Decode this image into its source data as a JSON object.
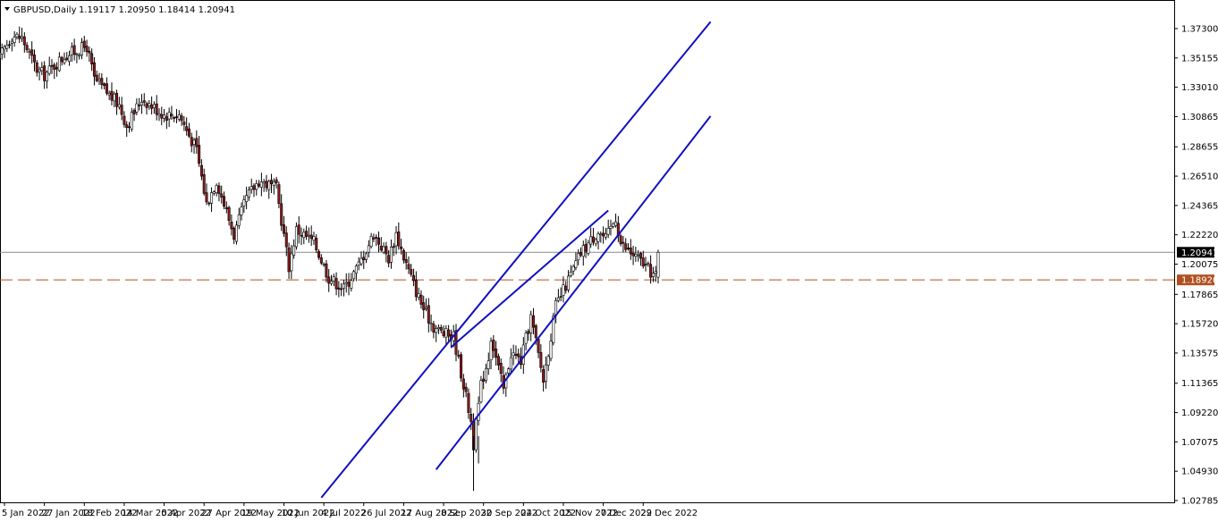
{
  "chart_header": {
    "symbol_label": "GBPUSD,Daily",
    "ohlc_text": "1.19117 1.20950 1.18414 1.20941"
  },
  "price_tags": {
    "current_price": "1.20941",
    "support_level": "1.18920"
  },
  "colors": {
    "background": "#ffffff",
    "bull_candle": "#ffffff",
    "bear_candle": "#8b1a1a",
    "candle_outline": "#000000",
    "channel_line": "#1010c0",
    "support_line": "#b05020",
    "current_line": "#8a8a8a",
    "current_tag_bg": "#000000",
    "support_tag_bg": "#b05020"
  },
  "chart_data": {
    "type": "candlestick",
    "title": "GBPUSD,Daily",
    "ylim": [
      1.02785,
      1.38445
    ],
    "y_ticks": [
      "1.37300",
      "1.35155",
      "1.33010",
      "1.30865",
      "1.28655",
      "1.26510",
      "1.24365",
      "1.22220",
      "1.20075",
      "1.17865",
      "1.15720",
      "1.13575",
      "1.11365",
      "1.09220",
      "1.07075",
      "1.04930",
      "1.02785"
    ],
    "x_ticks": [
      "5 Jan 2022",
      "27 Jan 2022",
      "18 Feb 2022",
      "14 Mar 2022",
      "5 Apr 2022",
      "27 Apr 2022",
      "19 May 2022",
      "10 Jun 2022",
      "4 Jul 2022",
      "26 Jul 2022",
      "17 Aug 2022",
      "8 Sep 2022",
      "30 Sep 2022",
      "24 Oct 2022",
      "15 Nov 2022",
      "7 Dec 2022",
      "29 Dec 2022"
    ],
    "horizontal_lines": [
      {
        "name": "current",
        "value": 1.20941,
        "style": "solid"
      },
      {
        "name": "support",
        "value": 1.1892,
        "style": "dashed"
      }
    ],
    "trend_lines": [
      {
        "name": "channel-upper-long",
        "from": {
          "x": "1 Jul 2022",
          "y": 1.03
        },
        "to": {
          "x": "6 Feb 2023",
          "y": 1.378
        }
      },
      {
        "name": "channel-lower-long",
        "from": {
          "x": "5 Sep 2022",
          "y": 1.0505
        },
        "to": {
          "x": "6 Feb 2023",
          "y": 1.309
        }
      },
      {
        "name": "channel-upper-short",
        "from": {
          "x": "13 Sep 2022",
          "y": 1.14
        },
        "to": {
          "x": "10 Dec 2022",
          "y": 1.24
        }
      }
    ],
    "anchors": [
      {
        "date": "3 Jan 2022",
        "close": 1.352
      },
      {
        "date": "10 Jan 2022",
        "close": 1.368
      },
      {
        "date": "14 Jan 2022",
        "close": 1.366
      },
      {
        "date": "24 Jan 2022",
        "close": 1.343
      },
      {
        "date": "27 Jan 2022",
        "close": 1.339
      },
      {
        "date": "8 Feb 2022",
        "close": 1.353
      },
      {
        "date": "21 Feb 2022",
        "close": 1.36
      },
      {
        "date": "24 Feb 2022",
        "close": 1.336
      },
      {
        "date": "10 Mar 2022",
        "close": 1.317
      },
      {
        "date": "15 Mar 2022",
        "close": 1.302
      },
      {
        "date": "23 Mar 2022",
        "close": 1.322
      },
      {
        "date": "5 Apr 2022",
        "close": 1.31
      },
      {
        "date": "13 Apr 2022",
        "close": 1.31
      },
      {
        "date": "22 Apr 2022",
        "close": 1.284
      },
      {
        "date": "28 Apr 2022",
        "close": 1.245
      },
      {
        "date": "4 May 2022",
        "close": 1.262
      },
      {
        "date": "13 May 2022",
        "close": 1.222
      },
      {
        "date": "20 May 2022",
        "close": 1.249
      },
      {
        "date": "27 May 2022",
        "close": 1.262
      },
      {
        "date": "7 Jun 2022",
        "close": 1.256
      },
      {
        "date": "14 Jun 2022",
        "close": 1.199
      },
      {
        "date": "17 Jun 2022",
        "close": 1.226
      },
      {
        "date": "28 Jun 2022",
        "close": 1.217
      },
      {
        "date": "6 Jul 2022",
        "close": 1.191
      },
      {
        "date": "14 Jul 2022",
        "close": 1.183
      },
      {
        "date": "22 Jul 2022",
        "close": 1.2
      },
      {
        "date": "1 Aug 2022",
        "close": 1.223
      },
      {
        "date": "9 Aug 2022",
        "close": 1.205
      },
      {
        "date": "12 Aug 2022",
        "close": 1.223
      },
      {
        "date": "17 Aug 2022",
        "close": 1.206
      },
      {
        "date": "24 Aug 2022",
        "close": 1.181
      },
      {
        "date": "29 Aug 2022",
        "close": 1.168
      },
      {
        "date": "2 Sep 2022",
        "close": 1.155
      },
      {
        "date": "8 Sep 2022",
        "close": 1.15
      },
      {
        "date": "14 Sep 2022",
        "close": 1.148
      },
      {
        "date": "23 Sep 2022",
        "close": 1.086
      },
      {
        "date": "26 Sep 2022",
        "close": 1.069
      },
      {
        "date": "29 Sep 2022",
        "close": 1.112
      },
      {
        "date": "4 Oct 2022",
        "close": 1.133
      },
      {
        "date": "5 Oct 2022",
        "close": 1.148
      },
      {
        "date": "12 Oct 2022",
        "close": 1.109
      },
      {
        "date": "17 Oct 2022",
        "close": 1.136
      },
      {
        "date": "21 Oct 2022",
        "close": 1.13
      },
      {
        "date": "27 Oct 2022",
        "close": 1.162
      },
      {
        "date": "3 Nov 2022",
        "close": 1.116
      },
      {
        "date": "10 Nov 2022",
        "close": 1.17
      },
      {
        "date": "17 Nov 2022",
        "close": 1.189
      },
      {
        "date": "24 Nov 2022",
        "close": 1.209
      },
      {
        "date": "5 Dec 2022",
        "close": 1.225
      },
      {
        "date": "8 Dec 2022",
        "close": 1.219
      },
      {
        "date": "14 Dec 2022",
        "close": 1.235
      },
      {
        "date": "16 Dec 2022",
        "close": 1.216
      },
      {
        "date": "20 Dec 2022",
        "close": 1.212
      },
      {
        "date": "28 Dec 2022",
        "close": 1.203
      },
      {
        "date": "3 Jan 2023",
        "close": 1.195
      },
      {
        "date": "5 Jan 2023",
        "close": 1.192
      },
      {
        "date": "6 Jan 2023",
        "close": 1.20941
      }
    ]
  }
}
